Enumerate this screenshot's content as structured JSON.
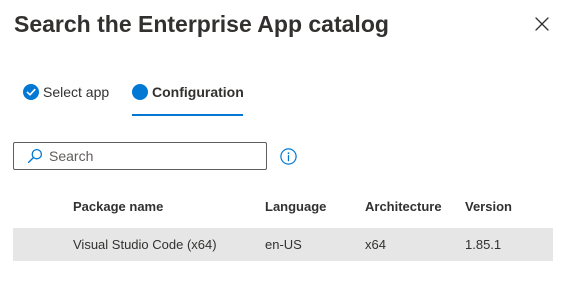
{
  "dialog": {
    "title": "Search the Enterprise App catalog",
    "close_icon": "close-icon"
  },
  "tabs": [
    {
      "label": "Select app",
      "icon": "checkmark-circle-icon",
      "state": "completed"
    },
    {
      "label": "Configuration",
      "icon": "filled-circle-icon",
      "state": "active"
    }
  ],
  "search": {
    "placeholder": "Search",
    "value": "",
    "icon": "search-icon"
  },
  "info_icon": "info-icon",
  "table": {
    "columns": [
      "Package name",
      "Language",
      "Architecture",
      "Version"
    ],
    "rows": [
      {
        "name": "Visual Studio Code (x64)",
        "language": "en-US",
        "architecture": "x64",
        "version": "1.85.1",
        "selected": true
      }
    ]
  },
  "colors": {
    "accent": "#0078d4",
    "text": "#323130",
    "row_selected_bg": "#e6e6e6",
    "border": "#605e5c"
  }
}
